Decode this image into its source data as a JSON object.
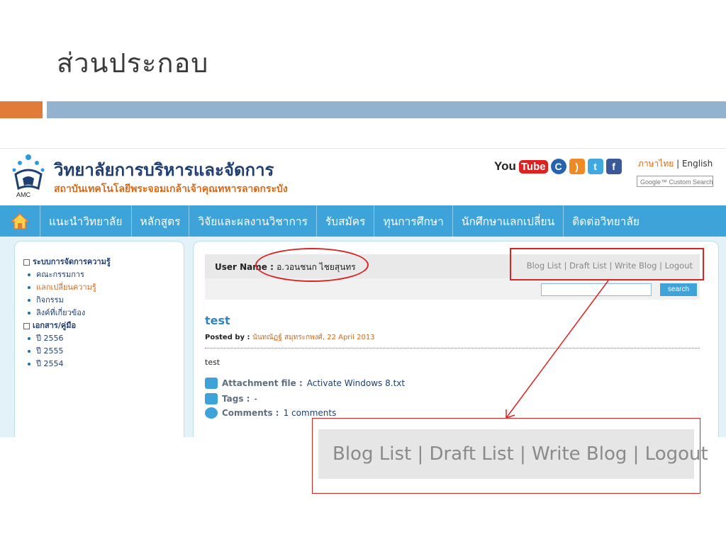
{
  "slide": {
    "title": "ส่วนประกอบ"
  },
  "site": {
    "logo_text": "AMC",
    "college_name": "วิทยาลัยการบริหารและจัดการ",
    "college_sub": "สถาบันเทคโนโลยีพระจอมเกล้าเจ้าคุณทหารลาดกระบัง",
    "social": {
      "youtube_you": "You",
      "youtube_tube": "Tube",
      "icons": [
        "chrome-icon",
        "rss-icon",
        "twitter-icon",
        "facebook-icon"
      ]
    },
    "lang_thai": "ภาษาไทย",
    "lang_sep": " | ",
    "lang_english": "English",
    "google_search_label": "Google™ Custom Search",
    "nav": [
      "แนะนำวิทยาลัย",
      "หลักสูตร",
      "วิจัยและผลงานวิชาการ",
      "รับสมัคร",
      "ทุนการศึกษา",
      "นักศึกษาแลกเปลี่ยน",
      "ติดต่อวิทยาลัย"
    ],
    "sidebar": {
      "section1": "ระบบการจัดการความรู้",
      "section1_items": [
        "คณะกรรมการ",
        "แลกเปลี่ยนความรู้",
        "กิจกรรม",
        "ลิงค์ที่เกี่ยวข้อง"
      ],
      "section2": "เอกสาร/คู่มือ",
      "section2_items": [
        "ปี 2556",
        "ปี 2555",
        "ปี 2554"
      ]
    },
    "main": {
      "user_label": "User Name : ",
      "user_value": "อ.วอนชนก ไชยสุนทร",
      "blog_links": "Blog List | Draft List | Write Blog | Logout",
      "search_button": "search",
      "post_title": "test",
      "posted_label": "Posted by : ",
      "posted_value": "นันทณัฏฐ์ สมุทระกพงศ์, 22 April 2013",
      "post_body": "test",
      "attachment_label": "Attachment file : ",
      "attachment_value": "Activate Windows 8.txt",
      "tags_label": "Tags : ",
      "tags_value": "-",
      "comments_label": "Comments : ",
      "comments_value": "1 comments"
    }
  },
  "zoom": {
    "text": "Blog List | Draft List | Write Blog | Logout"
  },
  "colors": {
    "accent_orange": "#e07b39",
    "bar_blue": "#93b2cf",
    "nav_blue": "#3da3d9",
    "annotation_red": "#dd2222"
  }
}
